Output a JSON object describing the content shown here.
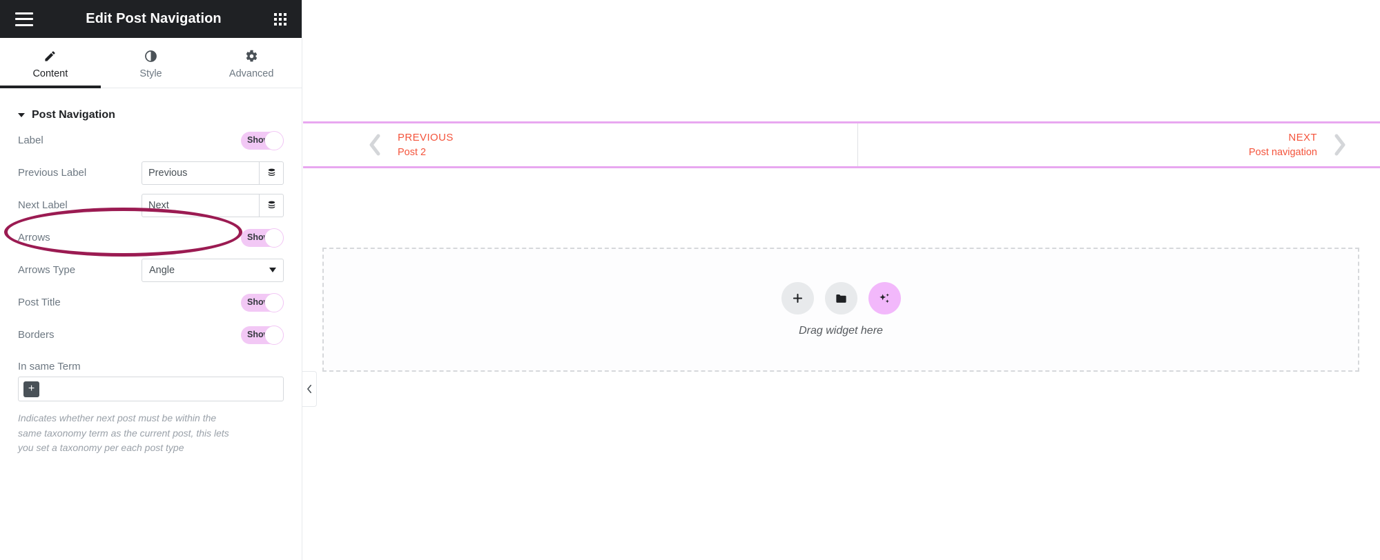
{
  "panel": {
    "header": {
      "title": "Edit Post Navigation",
      "menu_icon": "hamburger-icon",
      "apps_icon": "grid-apps-icon"
    },
    "tabs": [
      {
        "label": "Content",
        "icon": "pencil-icon",
        "active": true
      },
      {
        "label": "Style",
        "icon": "contrast-half-circle-icon",
        "active": false
      },
      {
        "label": "Advanced",
        "icon": "gear-icon",
        "active": false
      }
    ],
    "section": {
      "title": "Post Navigation",
      "expanded": true
    },
    "controls": [
      {
        "key": "label",
        "label": "Label",
        "type": "toggle",
        "value": "Show"
      },
      {
        "key": "previous_label",
        "label": "Previous Label",
        "type": "text",
        "value": "Previous",
        "placeholder": "Previous",
        "dynamic_icon": "dynamic-tags-icon"
      },
      {
        "key": "next_label",
        "label": "Next Label",
        "type": "text",
        "value": "Next",
        "placeholder": "Next",
        "dynamic_icon": "dynamic-tags-icon"
      },
      {
        "key": "arrows",
        "label": "Arrows",
        "type": "toggle",
        "value": "Show"
      },
      {
        "key": "arrows_type",
        "label": "Arrows Type",
        "type": "select",
        "value": "Angle"
      },
      {
        "key": "post_title",
        "label": "Post Title",
        "type": "toggle",
        "value": "Show"
      },
      {
        "key": "borders",
        "label": "Borders",
        "type": "toggle",
        "value": "Show"
      }
    ],
    "in_same_term": {
      "label": "In same Term",
      "add_label": "+",
      "help": "Indicates whether next post must be within the same taxonomy term as the current post, this lets you set a taxonomy per each post type"
    },
    "collapse_icon": "chevron-left-icon"
  },
  "annotation": {
    "shape": "ellipse",
    "color": "#9b1b52",
    "targets": "arrows-toggle-row"
  },
  "canvas": {
    "post_navigation": {
      "previous": {
        "kicker": "PREVIOUS",
        "title": "Post 2",
        "arrow_icon": "chevron-left-icon"
      },
      "next": {
        "kicker": "NEXT",
        "title": "Post navigation",
        "arrow_icon": "chevron-right-icon"
      },
      "border_color": "#e8a7f0"
    },
    "dropzone": {
      "label": "Drag widget here",
      "buttons": [
        {
          "name": "add-widget-button",
          "icon": "plus-icon"
        },
        {
          "name": "add-template-button",
          "icon": "folder-icon"
        },
        {
          "name": "ai-button",
          "icon": "sparkle-ai-icon"
        }
      ]
    }
  },
  "colors": {
    "toggle_on": "#f2c8f5",
    "accent_pink": "#e8a7f0",
    "nav_text": "#f4543c",
    "header_bg": "#1f2124",
    "annotation": "#9b1b52"
  }
}
